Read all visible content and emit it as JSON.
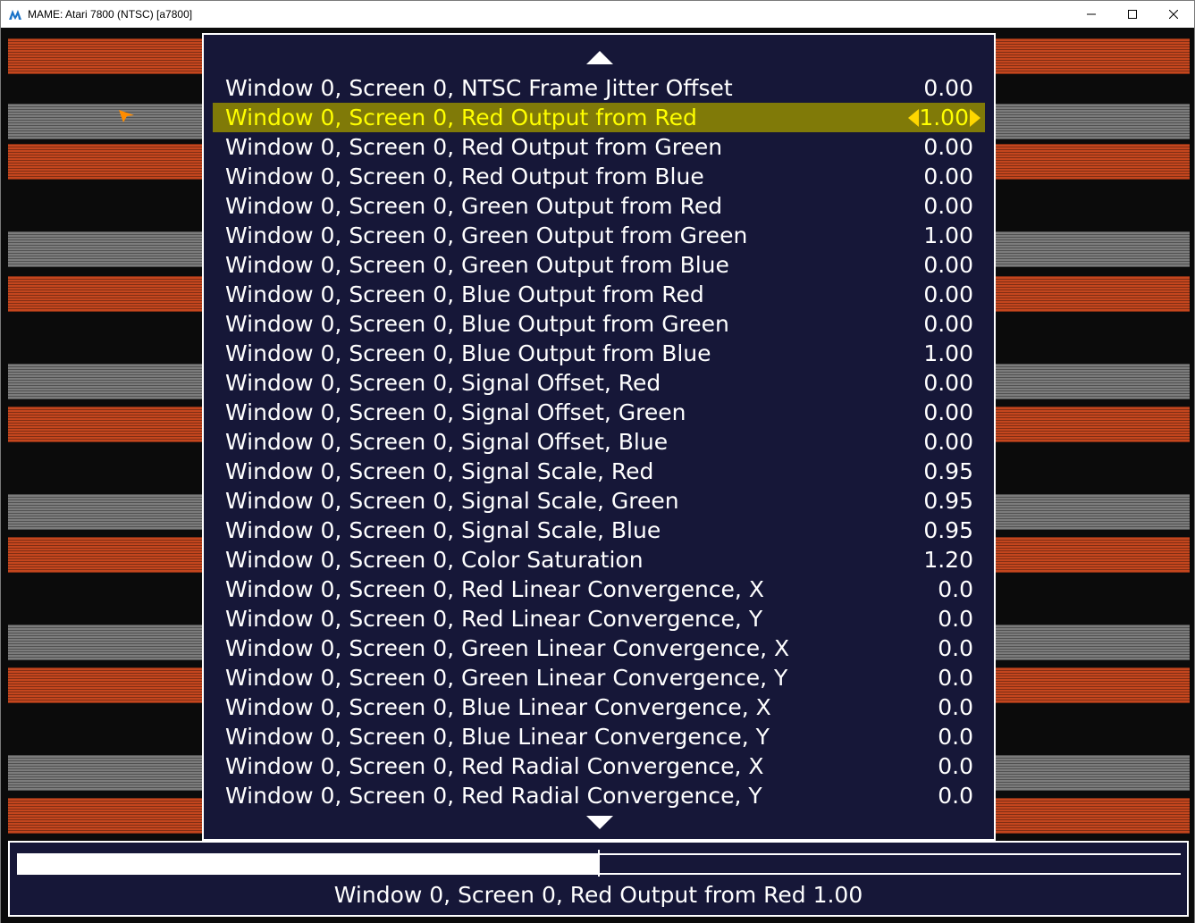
{
  "window": {
    "title": "MAME: Atari 7800 (NTSC) [a7800]",
    "controls": [
      "minimize-icon",
      "maximize-icon",
      "close-icon"
    ]
  },
  "menu": {
    "scroll_up_icon": "triangle-up-icon",
    "scroll_down_icon": "triangle-down-icon",
    "selected_index": 1,
    "items": [
      {
        "label": "Window 0, Screen 0, NTSC Frame Jitter Offset",
        "value": "0.00"
      },
      {
        "label": "Window 0, Screen 0, Red Output from Red",
        "value": "1.00"
      },
      {
        "label": "Window 0, Screen 0, Red Output from Green",
        "value": "0.00"
      },
      {
        "label": "Window 0, Screen 0, Red Output from Blue",
        "value": "0.00"
      },
      {
        "label": "Window 0, Screen 0, Green Output from Red",
        "value": "0.00"
      },
      {
        "label": "Window 0, Screen 0, Green Output from Green",
        "value": "1.00"
      },
      {
        "label": "Window 0, Screen 0, Green Output from Blue",
        "value": "0.00"
      },
      {
        "label": "Window 0, Screen 0, Blue Output from Red",
        "value": "0.00"
      },
      {
        "label": "Window 0, Screen 0, Blue Output from Green",
        "value": "0.00"
      },
      {
        "label": "Window 0, Screen 0, Blue Output from Blue",
        "value": "1.00"
      },
      {
        "label": "Window 0, Screen 0, Signal Offset, Red",
        "value": "0.00"
      },
      {
        "label": "Window 0, Screen 0, Signal Offset, Green",
        "value": "0.00"
      },
      {
        "label": "Window 0, Screen 0, Signal Offset, Blue",
        "value": "0.00"
      },
      {
        "label": "Window 0, Screen 0, Signal Scale, Red",
        "value": "0.95"
      },
      {
        "label": "Window 0, Screen 0, Signal Scale, Green",
        "value": "0.95"
      },
      {
        "label": "Window 0, Screen 0, Signal Scale, Blue",
        "value": "0.95"
      },
      {
        "label": "Window 0, Screen 0, Color Saturation",
        "value": "1.20"
      },
      {
        "label": "Window 0, Screen 0, Red Linear Convergence, X",
        "value": "0.0"
      },
      {
        "label": "Window 0, Screen 0, Red Linear Convergence, Y",
        "value": "0.0"
      },
      {
        "label": "Window 0, Screen 0, Green Linear Convergence, X",
        "value": "0.0"
      },
      {
        "label": "Window 0, Screen 0, Green Linear Convergence, Y",
        "value": "0.0"
      },
      {
        "label": "Window 0, Screen 0, Blue Linear Convergence, X",
        "value": "0.0"
      },
      {
        "label": "Window 0, Screen 0, Blue Linear Convergence, Y",
        "value": "0.0"
      },
      {
        "label": "Window 0, Screen 0, Red Radial Convergence, X",
        "value": "0.0"
      },
      {
        "label": "Window 0, Screen 0, Red Radial Convergence, Y",
        "value": "0.0"
      }
    ]
  },
  "slider": {
    "text": "Window 0, Screen 0, Red Output from Red 1.00",
    "fill_fraction": 0.5
  },
  "colors": {
    "menu_background": "#161738",
    "selected_row_background": "#807a08",
    "selected_text": "#ffff00",
    "text": "#ffffff",
    "stripe_orange": "#c4461e",
    "stripe_gray": "#7c7c7c",
    "cursor": "#ff8c00"
  }
}
